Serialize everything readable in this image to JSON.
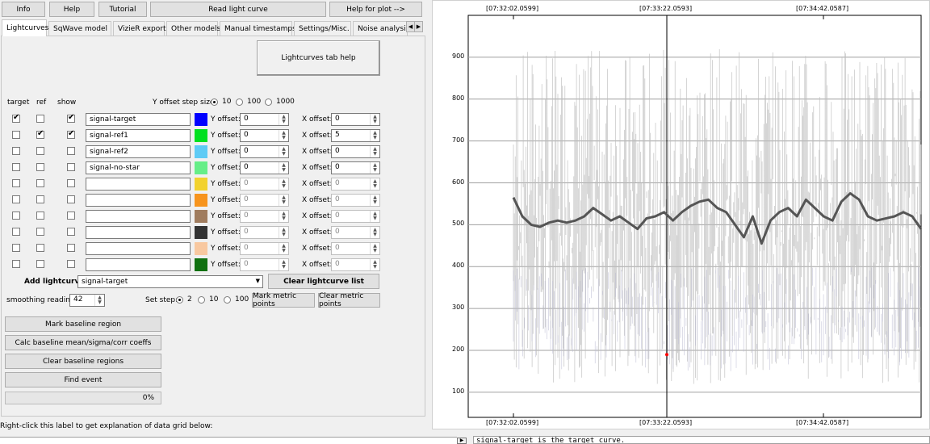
{
  "top_buttons": {
    "info": "Info",
    "help": "Help",
    "tutorial": "Tutorial",
    "read_light_curve": "Read light curve",
    "help_for_plot": "Help for plot -->"
  },
  "tabs": [
    "Lightcurves",
    "SqWave model",
    "VizieR export",
    "Other models",
    "Manual timestamps",
    "Settings/Misc.",
    "Noise analysis/I"
  ],
  "tab_help_button": "Lightcurves tab help",
  "headers": {
    "target": "target",
    "ref": "ref",
    "show": "show"
  },
  "y_offset_step": {
    "label": "Y offset step size:",
    "options": [
      "10",
      "100",
      "1000"
    ],
    "selected": "10"
  },
  "rows": [
    {
      "target": true,
      "ref": false,
      "show": true,
      "name": "signal-target",
      "color": "#0000ff",
      "y_label": "Y offset:",
      "y": "0",
      "x_label": "X offset:",
      "x": "0",
      "enabled": true
    },
    {
      "target": false,
      "ref": true,
      "show": true,
      "name": "signal-ref1",
      "color": "#00e020",
      "y_label": "Y offset:",
      "y": "0",
      "x_label": "X offset:",
      "x": "5",
      "enabled": true
    },
    {
      "target": false,
      "ref": false,
      "show": false,
      "name": "signal-ref2",
      "color": "#5ecbf5",
      "y_label": "Y offset:",
      "y": "0",
      "x_label": "X offset:",
      "x": "0",
      "enabled": true
    },
    {
      "target": false,
      "ref": false,
      "show": false,
      "name": "signal-no-star",
      "color": "#66ee88",
      "y_label": "Y offset:",
      "y": "0",
      "x_label": "X offset:",
      "x": "0",
      "enabled": true
    },
    {
      "target": false,
      "ref": false,
      "show": false,
      "name": "",
      "color": "#f2d22e",
      "y_label": "Y offset:",
      "y": "0",
      "x_label": "X offset:",
      "x": "0",
      "enabled": false
    },
    {
      "target": false,
      "ref": false,
      "show": false,
      "name": "",
      "color": "#f7941d",
      "y_label": "Y offset:",
      "y": "0",
      "x_label": "X offset:",
      "x": "0",
      "enabled": false
    },
    {
      "target": false,
      "ref": false,
      "show": false,
      "name": "",
      "color": "#a07c5e",
      "y_label": "Y offset:",
      "y": "0",
      "x_label": "X offset:",
      "x": "0",
      "enabled": false
    },
    {
      "target": false,
      "ref": false,
      "show": false,
      "name": "",
      "color": "#333333",
      "y_label": "Y offset:",
      "y": "0",
      "x_label": "X offset:",
      "x": "0",
      "enabled": false
    },
    {
      "target": false,
      "ref": false,
      "show": false,
      "name": "",
      "color": "#f8c8a0",
      "y_label": "Y offset:",
      "y": "0",
      "x_label": "X offset:",
      "x": "0",
      "enabled": false
    },
    {
      "target": false,
      "ref": false,
      "show": false,
      "name": "",
      "color": "#107010",
      "y_label": "Y offset:",
      "y": "0",
      "x_label": "X offset:",
      "x": "0",
      "enabled": false
    }
  ],
  "add_lightcurve": {
    "label": "Add lightcurve",
    "selected": "signal-target",
    "clear_button": "Clear lightcurve list"
  },
  "smoothing": {
    "label": "smoothing readings",
    "value": "42"
  },
  "set_step": {
    "label": "Set step:",
    "options": [
      "2",
      "10",
      "100"
    ],
    "selected": "2"
  },
  "metric_buttons": {
    "mark": "Mark metric points",
    "clear": "Clear metric points"
  },
  "action_buttons": [
    "Mark baseline region",
    "Calc baseline mean/sigma/corr coeffs",
    "Clear baseline regions",
    "Find event"
  ],
  "progress": {
    "percent": 0,
    "text": "0%"
  },
  "bottom_label": "Right-click this label to get explanation of data grid below:",
  "log_text": "signal-target is the target curve.",
  "colors": {
    "accent": "#0078d7",
    "smooth_line": "#555555",
    "noise": "#bdbdbd",
    "marker": "#ff0000"
  },
  "chart_data": {
    "type": "line",
    "x_tick_labels_top": [
      "[07:32:02.0599]",
      "[07:33:22.0593]",
      "[07:34:42.0587]"
    ],
    "x_tick_labels_bottom": [
      "[07:32:02.0599]",
      "[07:33:22.0593]",
      "[07:34:42.0587]"
    ],
    "y_ticks": [
      100,
      200,
      300,
      400,
      500,
      600,
      700,
      800,
      900
    ],
    "ylim": [
      40,
      1000
    ],
    "cursor_x": "[07:33:22.0593]",
    "grid": true,
    "series": [
      {
        "values": [
          565,
          520,
          500,
          495,
          505,
          510,
          505,
          510,
          520,
          540,
          525,
          510,
          520,
          505,
          490,
          515,
          520,
          530,
          510,
          530,
          545,
          555,
          560,
          540,
          530,
          500,
          470,
          520,
          455,
          510,
          530,
          540,
          520,
          560,
          540,
          520,
          510,
          555,
          575,
          560,
          520,
          510,
          515,
          520,
          530,
          520,
          490
        ]
      }
    ],
    "marker": {
      "x": "[07:33:22.0593]",
      "y": 190
    }
  }
}
